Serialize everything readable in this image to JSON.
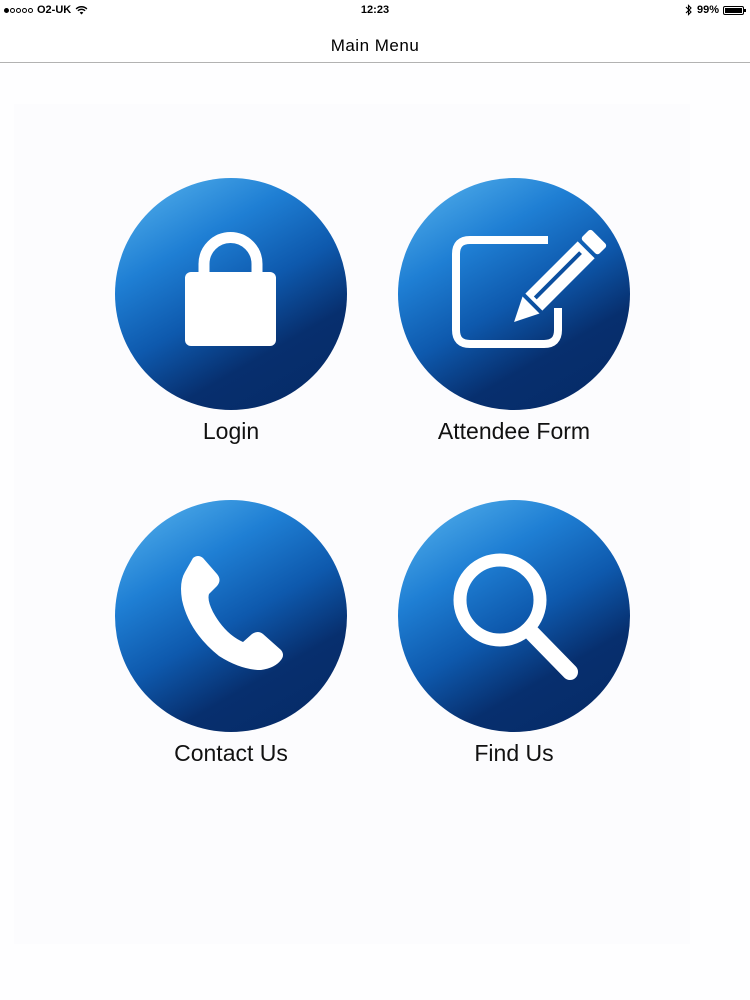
{
  "status_bar": {
    "carrier": "O2-UK",
    "time": "12:23",
    "battery": "99%",
    "battery_level": 0.99,
    "signal_bars_filled": 1,
    "signal_bars_total": 5,
    "icons": [
      "wifi-icon",
      "bluetooth-icon",
      "battery-icon"
    ]
  },
  "nav": {
    "title": "Main Menu"
  },
  "menu": {
    "items": [
      {
        "label": "Login",
        "icon": "lock-icon"
      },
      {
        "label": "Attendee Form",
        "icon": "edit-pencil-icon"
      },
      {
        "label": "Contact Us",
        "icon": "phone-icon"
      },
      {
        "label": "Find Us",
        "icon": "magnifier-icon"
      }
    ]
  },
  "colors": {
    "tile_gradient_light": "#5ab6ee",
    "tile_gradient_dark": "#062a66",
    "icon_color": "#ffffff"
  }
}
